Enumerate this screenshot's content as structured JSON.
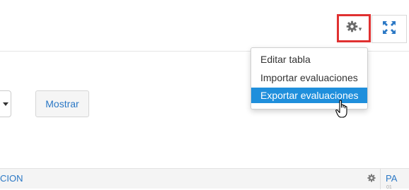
{
  "toolbar": {
    "settings_icon": "gear-icon",
    "settings_chevron": "▾",
    "fullscreen_icon": "expand-icon"
  },
  "filter": {
    "show_button": "Mostrar"
  },
  "settings_menu": {
    "items": [
      {
        "label": "Editar tabla",
        "state": "default"
      },
      {
        "label": "Importar evaluaciones",
        "state": "default"
      },
      {
        "label": "Exportar evaluaciones",
        "state": "hover"
      }
    ],
    "highlight_color": "#1f8fdc"
  },
  "table": {
    "headers": [
      {
        "label": "CION",
        "icon": "gear-icon"
      },
      {
        "label": "PA",
        "sub": "01"
      }
    ]
  },
  "colors": {
    "link": "#2b78c5",
    "highlight_box": "#e03131"
  }
}
